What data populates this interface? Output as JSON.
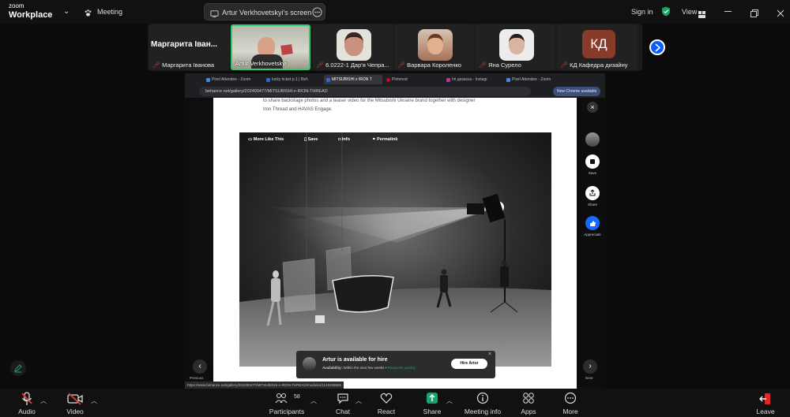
{
  "app": {
    "logo_small": "zoom",
    "logo_main": "Workplace",
    "meeting_label": "Meeting"
  },
  "share": {
    "title": "Artur Verkhovetskyi's screen"
  },
  "top_right": {
    "sign_in": "Sign in",
    "view": "View"
  },
  "gallery": {
    "tiles": [
      {
        "name": "Маргарита Іванова",
        "big_name": "Маргарита Іван...",
        "muted": true
      },
      {
        "name": "Artur Verkhovetskyi",
        "muted": false
      },
      {
        "name": "6.0222-1 Дар'я Чепра...",
        "muted": true
      },
      {
        "name": "Варвара Короленко",
        "muted": true
      },
      {
        "name": "Яна Сурело",
        "muted": true
      },
      {
        "name": "КД Кафедра дизайну",
        "initials": "КД",
        "muted": true
      }
    ]
  },
  "browser": {
    "tabs": [
      "Pixel Attendee - Zoom",
      "lucky ticket p.1 | Beh",
      "MITSUBISHI x IRON T",
      "Pinterest",
      "Ілі дизаска - Instagr",
      "Pixel Attendee - Zoom"
    ],
    "url": "behance.net/gallery/202400477/MITSUBISHI-x-IRON-THREAD",
    "chrome_badge": "New Chrome available",
    "status_url": "https://www.behance.net/gallery/202400477/MITSUBISHI-x-IRON-THREAD/modules/1149158655"
  },
  "project": {
    "intro_line1": "to share backstage photos and a teaser video for the Mitsubishi Ukraine brand together with designer",
    "intro_line2": "Iron Thread and HAVAS Engage.",
    "photo_buttons": {
      "more_like": "More Like This",
      "save": "Save",
      "info": "Info",
      "permalink": "Permalink"
    }
  },
  "sidebar": {
    "save": "Save",
    "share": "Share",
    "appreciate": "Appreciate",
    "next": "Next",
    "previous": "Previous"
  },
  "hire": {
    "title": "Artur is available for hire",
    "availability_label": "Availability:",
    "availability_value": "Within the next few weeks",
    "responds": "Responds quickly",
    "button": "Hire Artur"
  },
  "toolbar": {
    "audio": "Audio",
    "video": "Video",
    "participants": "Participants",
    "participants_count": "58",
    "chat": "Chat",
    "react": "React",
    "share": "Share",
    "meeting_info": "Meeting info",
    "apps": "Apps",
    "more": "More",
    "leave": "Leave"
  },
  "colors": {
    "accent_green": "#1aa36f",
    "gallery_active": "#2ecc71",
    "zoom_blue": "#0b5cff",
    "leave_red": "#e02828",
    "muted_red": "#e53935"
  }
}
